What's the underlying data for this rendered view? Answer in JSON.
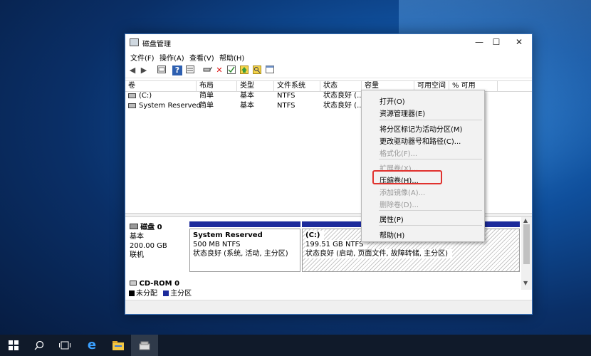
{
  "window": {
    "title": "磁盘管理",
    "controls": {
      "minimize": "—",
      "maximize": "☐",
      "close": "✕"
    }
  },
  "menu": [
    "文件(F)",
    "操作(A)",
    "查看(V)",
    "帮助(H)"
  ],
  "toolbar_icons": [
    "back-icon",
    "forward-icon",
    "console-icon",
    "help-icon",
    "properties-icon",
    "connect-icon",
    "delete-icon",
    "check-icon",
    "up-icon",
    "search-icon",
    "window-icon"
  ],
  "table": {
    "columns": [
      "卷",
      "布局",
      "类型",
      "文件系统",
      "状态",
      "容量",
      "可用空间",
      "% 可用"
    ],
    "rows": [
      {
        "volume": "(C:)",
        "layout": "简单",
        "type": "基本",
        "fs": "NTFS",
        "status": "状态良好 (..."
      },
      {
        "volume": "System Reserved",
        "layout": "简单",
        "type": "基本",
        "fs": "NTFS",
        "status": "状态良好 (..."
      }
    ]
  },
  "disk0": {
    "name": "磁盘 0",
    "type": "基本",
    "size": "200.00 GB",
    "state": "联机",
    "partitions": [
      {
        "name": "System Reserved",
        "size": "500 MB NTFS",
        "status": "状态良好 (系统, 活动, 主分区)"
      },
      {
        "name": "(C:)",
        "size": "199.51 GB NTFS",
        "status": "状态良好 (启动, 页面文件, 故障转储, 主分区)"
      }
    ]
  },
  "cdrom": {
    "name": "CD-ROM 0"
  },
  "legend": [
    {
      "label": "未分配",
      "color": "#000000"
    },
    {
      "label": "主分区",
      "color": "#1d2b9b"
    }
  ],
  "context_menu": {
    "items": [
      {
        "label": "打开(O)",
        "enabled": true
      },
      {
        "label": "资源管理器(E)",
        "enabled": true
      },
      {
        "label": "将分区标记为活动分区(M)",
        "enabled": true
      },
      {
        "label": "更改驱动器号和路径(C)...",
        "enabled": true
      },
      {
        "label": "格式化(F)...",
        "enabled": false
      },
      {
        "label": "扩展卷(X)...",
        "enabled": false
      },
      {
        "label": "压缩卷(H)...",
        "enabled": true
      },
      {
        "label": "添加镜像(A)...",
        "enabled": false
      },
      {
        "label": "删除卷(D)...",
        "enabled": false
      },
      {
        "label": "属性(P)",
        "enabled": true
      },
      {
        "label": "帮助(H)",
        "enabled": true
      }
    ],
    "highlighted": "压缩卷(H)..."
  },
  "taskbar": [
    "windows-start-icon",
    "search-icon",
    "task-view-icon",
    "edge-icon",
    "file-explorer-icon",
    "disk-management-icon"
  ],
  "colors": {
    "accent": "#1d2b9b",
    "highlight_box": "#e0322e",
    "taskbar": "#101a2a"
  }
}
